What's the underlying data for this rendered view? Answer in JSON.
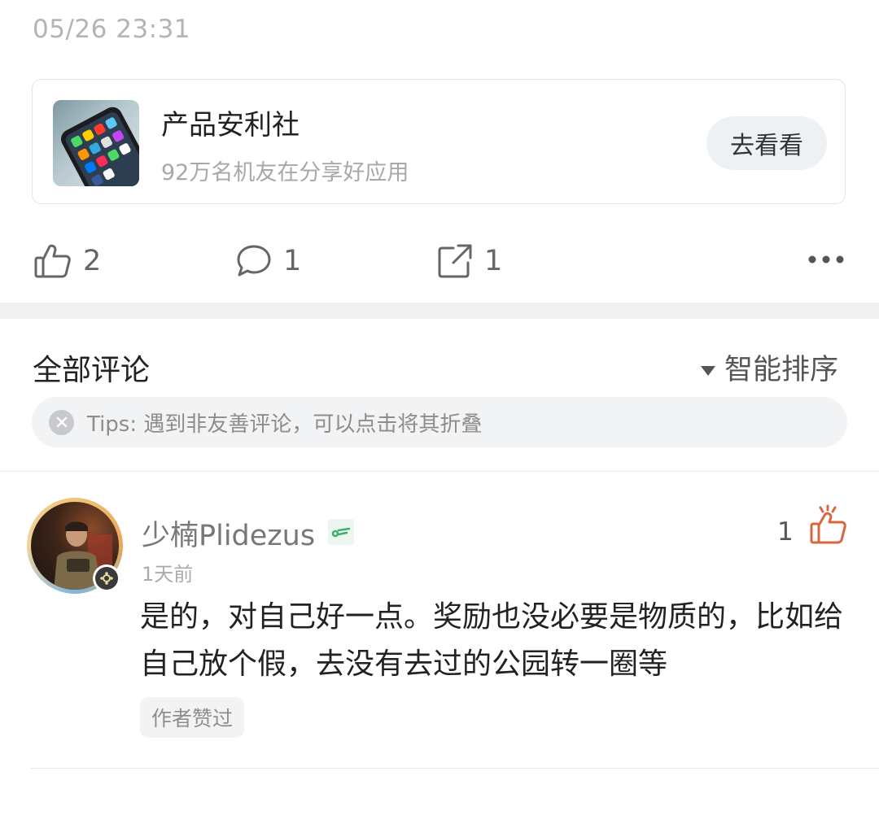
{
  "post": {
    "timestamp": "05/26 23:31"
  },
  "app_card": {
    "title": "产品安利社",
    "subtitle": "92万名机友在分享好应用",
    "button_label": "去看看",
    "thumbnail_icon": "phone-apps-thumbnail"
  },
  "actions": {
    "like_count": "2",
    "comment_count": "1",
    "share_count": "1"
  },
  "comments_section": {
    "title": "全部评论",
    "sort_label": "智能排序",
    "tips": "Tips: 遇到非友善评论，可以点击将其折叠"
  },
  "comments": [
    {
      "username": "少楠Plidezus",
      "time": "1天前",
      "like_count": "1",
      "body": "是的，对自己好一点。奖励也没必要是物质的，比如给自己放个假，去没有去过的公园转一圈等",
      "tag": "作者赞过"
    }
  ],
  "colors": {
    "accent_orange": "#d9663f",
    "level_green": "#3fae6a",
    "divider_band": "#eef0f2"
  }
}
